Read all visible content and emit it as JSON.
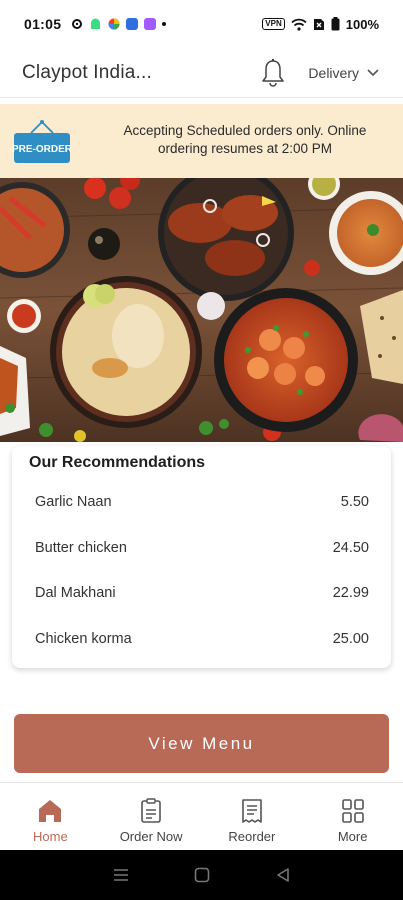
{
  "status_bar": {
    "time": "01:05",
    "battery": "100%",
    "vpn_label": "VPN"
  },
  "header": {
    "title": "Claypot India...",
    "delivery_label": "Delivery",
    "icons": [
      "bell-icon",
      "chevron-down-icon"
    ]
  },
  "banner": {
    "badge_text": "PRE-ORDER",
    "message": "Accepting Scheduled orders only. Online ordering resumes at 2:00 PM"
  },
  "recommendations": {
    "title": "Our Recommendations",
    "items": [
      {
        "name": "Garlic Naan",
        "price": "5.50"
      },
      {
        "name": "Butter chicken",
        "price": "24.50"
      },
      {
        "name": "Dal Makhani",
        "price": "22.99"
      },
      {
        "name": "Chicken korma",
        "price": "25.00"
      }
    ]
  },
  "cta": {
    "view_menu_label": "View Menu"
  },
  "bottom_nav": {
    "items": [
      {
        "label": "Home",
        "icon": "home-icon",
        "active": true
      },
      {
        "label": "Order Now",
        "icon": "order-clipboard-icon",
        "active": false
      },
      {
        "label": "Reorder",
        "icon": "receipt-icon",
        "active": false
      },
      {
        "label": "More",
        "icon": "grid-icon",
        "active": false
      }
    ]
  },
  "colors": {
    "accent": "#b86a57",
    "banner_bg": "#fbecd0",
    "preorder_blue": "#2f8fc4"
  }
}
